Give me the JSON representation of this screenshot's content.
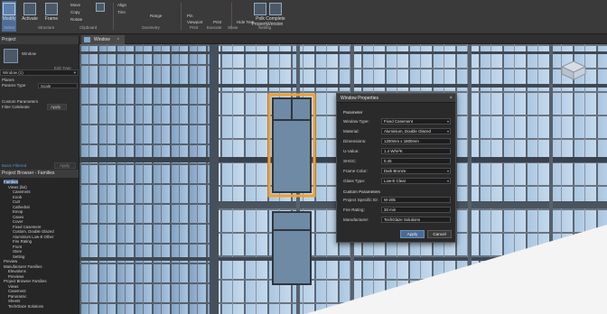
{
  "ribbon": {
    "modify": "Modify",
    "select": "Select",
    "activate": "Activate",
    "frame": "Frame",
    "structure": "Structure",
    "move": "Move",
    "copy": "Copy",
    "rotate": "Rotate",
    "clipboard": "Clipboard",
    "geometry": "Geometry",
    "align": "Align",
    "trim": "Trim",
    "range": "Range",
    "pin": "Pin",
    "viewport": "Viewport",
    "print": "Print",
    "execute": "Execute",
    "show": "Show",
    "hide_text": "Hide Text",
    "hide": "Hide",
    "polk_property": "Polk Property",
    "complete_version": "Complete Version",
    "setting": "Setting"
  },
  "tab": {
    "label": "Window",
    "close": "×"
  },
  "properties": {
    "header": "Project",
    "type_name": "Window",
    "edit_type": "Edit Type",
    "selector": "Window (1)",
    "section_params": "Planes",
    "param_row_label": "Params Type",
    "param_row_value": "Scale",
    "custom_params": "Custom Parameters",
    "filter_label": "Filter Celebrate",
    "apply_small": "Apply",
    "status_left": "Basic Filtered",
    "status_apply": "Apply"
  },
  "browser": {
    "header": "Project Browser - Families",
    "items": [
      {
        "label": "Families",
        "indent": 0,
        "selected": true
      },
      {
        "label": "Views (list)",
        "indent": 1
      },
      {
        "label": "Casement",
        "indent": 2
      },
      {
        "label": "Knob",
        "indent": 2
      },
      {
        "label": "Curt",
        "indent": 2
      },
      {
        "label": "Cathedral",
        "indent": 2
      },
      {
        "label": "Emop",
        "indent": 2
      },
      {
        "label": "Cases",
        "indent": 2
      },
      {
        "label": "Cover",
        "indent": 2
      },
      {
        "label": "Fixed Casement",
        "indent": 2
      },
      {
        "label": "Custom, Double Glazed",
        "indent": 2
      },
      {
        "label": "Aluminium Low-E Other",
        "indent": 2
      },
      {
        "label": "Fire Rating",
        "indent": 2
      },
      {
        "label": "Front",
        "indent": 2
      },
      {
        "label": "Store",
        "indent": 2
      },
      {
        "label": "Setting",
        "indent": 2
      },
      {
        "label": "Preview",
        "indent": 0
      },
      {
        "label": "Manufacturer Families",
        "indent": 0
      },
      {
        "label": "Elevations",
        "indent": 1
      },
      {
        "label": "Previews",
        "indent": 1
      },
      {
        "label": "Project Browser Families",
        "indent": 0
      },
      {
        "label": "Views",
        "indent": 1
      },
      {
        "label": "Casement",
        "indent": 1
      },
      {
        "label": "Panoramic",
        "indent": 1
      },
      {
        "label": "Sheets",
        "indent": 1
      },
      {
        "label": "TechGlaze Solutions",
        "indent": 1
      }
    ]
  },
  "dialog": {
    "title": "Window Properties",
    "close": "×",
    "section_header": "Parameter",
    "rows": [
      {
        "label": "Window Type:",
        "value": "Fixed Casement",
        "dropdown": true
      },
      {
        "label": "Material:",
        "value": "Aluminium, Double Glazed",
        "dropdown": true
      },
      {
        "label": "Dimensions:",
        "value": "1200mm x 1800mm",
        "dropdown": false
      },
      {
        "label": "U-Value:",
        "value": "1.4 W/m²K",
        "dropdown": false
      },
      {
        "label": "SHGC:",
        "value": "0.45",
        "dropdown": false
      },
      {
        "label": "Frame Color:",
        "value": "Dark Bronze",
        "dropdown": true
      },
      {
        "label": "Glass Type:",
        "value": "Low-E Clear",
        "dropdown": true
      },
      {
        "label": "Custom Parameters",
        "value": "",
        "dropdown": false,
        "header": true
      },
      {
        "label": "Project Specific ID:",
        "value": "W-205",
        "dropdown": false
      },
      {
        "label": "Fire Rating:",
        "value": "30 min",
        "dropdown": false
      },
      {
        "label": "Manufacturer:",
        "value": "TechGlaze Solutions",
        "dropdown": false
      }
    ],
    "apply": "Apply",
    "cancel": "Cancel"
  },
  "colors": {
    "selection_highlight": "#f0a030",
    "glass": "#9fc0df",
    "mullion": "#4a5560",
    "accent": "#4a6b92"
  }
}
